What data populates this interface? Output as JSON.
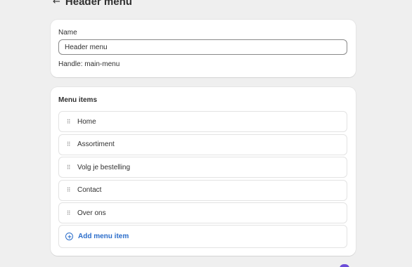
{
  "header": {
    "back_icon": "←",
    "title": "Header menu"
  },
  "name_card": {
    "label": "Name",
    "value": "Header menu",
    "handle": "Handle: main-menu"
  },
  "menu_card": {
    "title": "Menu items",
    "drag_icon": "⠿",
    "items": [
      {
        "label": "Home"
      },
      {
        "label": "Assortiment"
      },
      {
        "label": "Volg je bestelling"
      },
      {
        "label": "Contact"
      },
      {
        "label": "Over ons"
      }
    ],
    "add_label": "Add menu item"
  },
  "colors": {
    "accent": "#2c6ecb",
    "background": "#efefef",
    "badge": "#6b4bd8"
  }
}
